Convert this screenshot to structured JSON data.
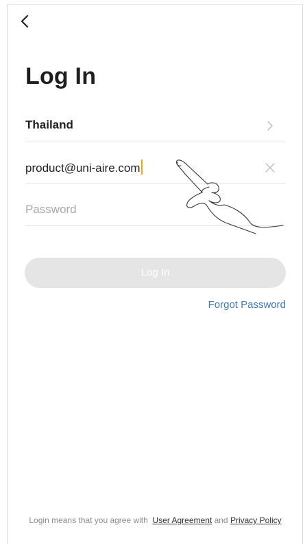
{
  "header": {
    "title": "Log In"
  },
  "form": {
    "country": "Thailand",
    "email": "product@uni-aire.com",
    "password_placeholder": "Password",
    "login_label": "Log In",
    "forgot_label": "Forgot Password"
  },
  "footer": {
    "prefix": "Login means that you agree with",
    "user_agreement": "User Agreement",
    "and": "and",
    "privacy_policy": "Privacy Policy"
  },
  "icons": {
    "back": "chevron-left-icon",
    "country_arrow": "chevron-right-icon",
    "clear": "close-icon",
    "gesture": "hand-pointer-illustration"
  },
  "colors": {
    "accent_link": "#3e79b7",
    "button_disabled": "#e5e5e5",
    "caret": "#f2a400"
  }
}
